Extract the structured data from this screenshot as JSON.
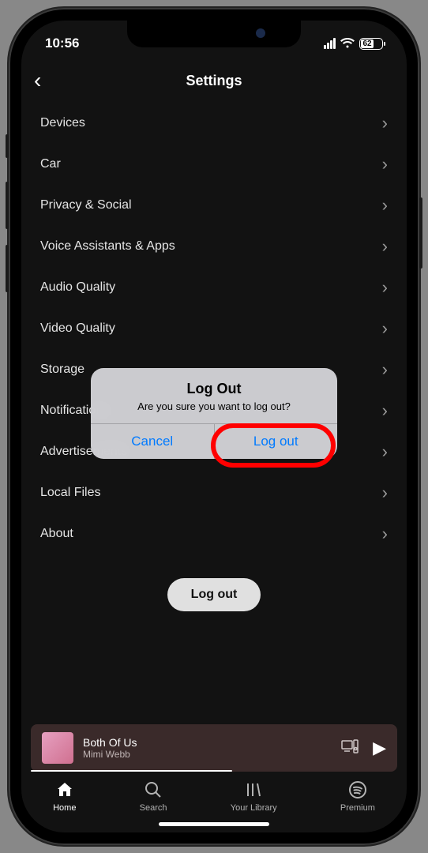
{
  "status_bar": {
    "time": "10:56",
    "battery_pct": "62"
  },
  "header": {
    "title": "Settings"
  },
  "settings": {
    "items": [
      {
        "label": "Devices"
      },
      {
        "label": "Car"
      },
      {
        "label": "Privacy & Social"
      },
      {
        "label": "Voice Assistants & Apps"
      },
      {
        "label": "Audio Quality"
      },
      {
        "label": "Video Quality"
      },
      {
        "label": "Storage"
      },
      {
        "label": "Notifications"
      },
      {
        "label": "Advertisements"
      },
      {
        "label": "Local Files"
      },
      {
        "label": "About"
      }
    ],
    "logout_label": "Log out"
  },
  "dialog": {
    "title": "Log Out",
    "message": "Are you sure you want to log out?",
    "cancel": "Cancel",
    "confirm": "Log out"
  },
  "now_playing": {
    "song": "Both Of Us",
    "artist": "Mimi Webb"
  },
  "tabs": {
    "home": "Home",
    "search": "Search",
    "library": "Your Library",
    "premium": "Premium"
  }
}
